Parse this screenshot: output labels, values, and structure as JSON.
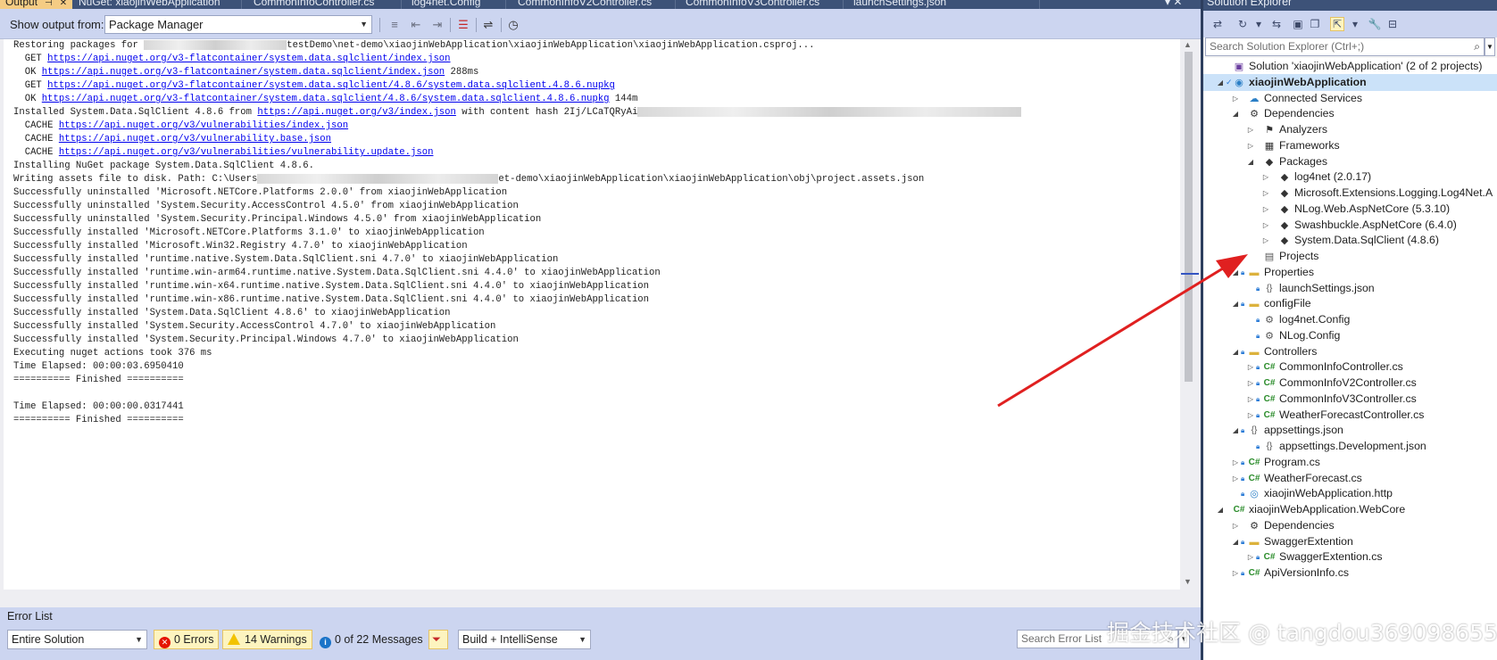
{
  "doc_tabs": {
    "output_title": "Output",
    "tabs": [
      "NuGet: xiaojinWebApplication",
      "CommonInfoController.cs",
      "log4net.Config",
      "CommonInfoV2Controller.cs",
      "CommonInfoV3Controller.cs",
      "launchSettings.json"
    ],
    "pin_icon": "pin-icon",
    "close_icon": "close-icon"
  },
  "output": {
    "show_output_label": "Show output from:",
    "source": "Package Manager",
    "lines": [
      {
        "text": "Restoring packages for ",
        "blur": 160,
        "after": "testDemo\\net-demo\\xiaojinWebApplication\\xiaojinWebApplication\\xiaojinWebApplication.csproj..."
      },
      {
        "text": "  GET ",
        "link": "https://api.nuget.org/v3-flatcontainer/system.data.sqlclient/index.json"
      },
      {
        "text": "  OK ",
        "link": "https://api.nuget.org/v3-flatcontainer/system.data.sqlclient/index.json",
        "after": " 288ms"
      },
      {
        "text": "  GET ",
        "link": "https://api.nuget.org/v3-flatcontainer/system.data.sqlclient/4.8.6/system.data.sqlclient.4.8.6.nupkg"
      },
      {
        "text": "  OK ",
        "link": "https://api.nuget.org/v3-flatcontainer/system.data.sqlclient/4.8.6/system.data.sqlclient.4.8.6.nupkg",
        "after": " 144m"
      },
      {
        "text": "Installed System.Data.SqlClient 4.8.6 from ",
        "link": "https://api.nuget.org/v3/index.json",
        "after": " with content hash 2Ij/LCaTQRyAi",
        "blur2": 430
      },
      {
        "text": "  CACHE ",
        "link": "https://api.nuget.org/v3/vulnerabilities/index.json"
      },
      {
        "text": "  CACHE ",
        "link": "https://api.nuget.org/v3/vulnerability.base.json"
      },
      {
        "text": "  CACHE ",
        "link": "https://api.nuget.org/v3/vulnerabilities/vulnerability.update.json"
      },
      {
        "text": "Installing NuGet package System.Data.SqlClient 4.8.6."
      },
      {
        "text": "Writing assets file to disk. Path: C:\\Users",
        "blur": 270,
        "after": "et-demo\\xiaojinWebApplication\\xiaojinWebApplication\\obj\\project.assets.json"
      },
      {
        "text": "Successfully uninstalled 'Microsoft.NETCore.Platforms 2.0.0' from xiaojinWebApplication"
      },
      {
        "text": "Successfully uninstalled 'System.Security.AccessControl 4.5.0' from xiaojinWebApplication"
      },
      {
        "text": "Successfully uninstalled 'System.Security.Principal.Windows 4.5.0' from xiaojinWebApplication"
      },
      {
        "text": "Successfully installed 'Microsoft.NETCore.Platforms 3.1.0' to xiaojinWebApplication"
      },
      {
        "text": "Successfully installed 'Microsoft.Win32.Registry 4.7.0' to xiaojinWebApplication"
      },
      {
        "text": "Successfully installed 'runtime.native.System.Data.SqlClient.sni 4.7.0' to xiaojinWebApplication"
      },
      {
        "text": "Successfully installed 'runtime.win-arm64.runtime.native.System.Data.SqlClient.sni 4.4.0' to xiaojinWebApplication"
      },
      {
        "text": "Successfully installed 'runtime.win-x64.runtime.native.System.Data.SqlClient.sni 4.4.0' to xiaojinWebApplication"
      },
      {
        "text": "Successfully installed 'runtime.win-x86.runtime.native.System.Data.SqlClient.sni 4.4.0' to xiaojinWebApplication"
      },
      {
        "text": "Successfully installed 'System.Data.SqlClient 4.8.6' to xiaojinWebApplication"
      },
      {
        "text": "Successfully installed 'System.Security.AccessControl 4.7.0' to xiaojinWebApplication"
      },
      {
        "text": "Successfully installed 'System.Security.Principal.Windows 4.7.0' to xiaojinWebApplication"
      },
      {
        "text": "Executing nuget actions took 376 ms"
      },
      {
        "text": "Time Elapsed: 00:00:03.6950410"
      },
      {
        "text": "========== Finished =========="
      },
      {
        "text": ""
      },
      {
        "text": "Time Elapsed: 00:00:00.0317441"
      },
      {
        "text": "========== Finished =========="
      }
    ]
  },
  "error_list": {
    "title": "Error List",
    "scope": "Entire Solution",
    "errors_label": "0 Errors",
    "warnings_label": "14 Warnings",
    "messages_label": "0 of 22 Messages",
    "build_filter": "Build + IntelliSense",
    "search_placeholder": "Search Error List"
  },
  "solution_explorer": {
    "title": "Solution Explorer",
    "search_placeholder": "Search Solution Explorer (Ctrl+;)",
    "tree": [
      {
        "label": "Solution 'xiaojinWebApplication' (2 of 2 projects)",
        "level": 0,
        "icon": "solution-icon",
        "glyph": "▣",
        "cls": "sol",
        "exp": ""
      },
      {
        "label": "xiaojinWebApplication",
        "level": 0,
        "icon": "web-project-icon",
        "glyph": "◉",
        "cls": "globe",
        "exp": "◢",
        "selected": true,
        "bold": true,
        "check": true
      },
      {
        "label": "Connected Services",
        "level": 1,
        "icon": "connected-services-icon",
        "glyph": "☁",
        "cls": "globe",
        "exp": "▷"
      },
      {
        "label": "Dependencies",
        "level": 1,
        "icon": "dependencies-icon",
        "glyph": "⚙",
        "cls": "pkg",
        "exp": "◢"
      },
      {
        "label": "Analyzers",
        "level": 2,
        "icon": "analyzers-icon",
        "glyph": "⚑",
        "cls": "pkg",
        "exp": "▷"
      },
      {
        "label": "Frameworks",
        "level": 2,
        "icon": "frameworks-icon",
        "glyph": "▦",
        "cls": "pkg",
        "exp": "▷"
      },
      {
        "label": "Packages",
        "level": 2,
        "icon": "packages-icon",
        "glyph": "◆",
        "cls": "pkg",
        "exp": "◢"
      },
      {
        "label": "log4net (2.0.17)",
        "level": 3,
        "icon": "package-icon",
        "glyph": "◆",
        "cls": "pkg",
        "exp": "▷"
      },
      {
        "label": "Microsoft.Extensions.Logging.Log4Net.A",
        "level": 3,
        "icon": "package-icon",
        "glyph": "◆",
        "cls": "pkg",
        "exp": "▷"
      },
      {
        "label": "NLog.Web.AspNetCore (5.3.10)",
        "level": 3,
        "icon": "package-icon",
        "glyph": "◆",
        "cls": "pkg",
        "exp": "▷"
      },
      {
        "label": "Swashbuckle.AspNetCore (6.4.0)",
        "level": 3,
        "icon": "package-icon",
        "glyph": "◆",
        "cls": "pkg",
        "exp": "▷"
      },
      {
        "label": "System.Data.SqlClient (4.8.6)",
        "level": 3,
        "icon": "package-icon",
        "glyph": "◆",
        "cls": "pkg",
        "exp": "▷"
      },
      {
        "label": "Projects",
        "level": 2,
        "icon": "projects-icon",
        "glyph": "▤",
        "cls": "file",
        "exp": ""
      },
      {
        "label": "Properties",
        "level": 1,
        "icon": "folder-icon",
        "glyph": "▬",
        "cls": "folder",
        "exp": "◢",
        "lock": true
      },
      {
        "label": "launchSettings.json",
        "level": 2,
        "icon": "json-file-icon",
        "glyph": "{}",
        "cls": "json",
        "exp": "",
        "lock": true
      },
      {
        "label": "configFile",
        "level": 1,
        "icon": "folder-icon",
        "glyph": "▬",
        "cls": "folder",
        "exp": "◢",
        "lock": true
      },
      {
        "label": "log4net.Config",
        "level": 2,
        "icon": "config-file-icon",
        "glyph": "⚙",
        "cls": "file",
        "exp": "",
        "lock": true
      },
      {
        "label": "NLog.Config",
        "level": 2,
        "icon": "config-file-icon",
        "glyph": "⚙",
        "cls": "file",
        "exp": "",
        "lock": true
      },
      {
        "label": "Controllers",
        "level": 1,
        "icon": "folder-icon",
        "glyph": "▬",
        "cls": "folder",
        "exp": "◢",
        "lock": true
      },
      {
        "label": "CommonInfoController.cs",
        "level": 2,
        "icon": "csharp-file-icon",
        "glyph": "C#",
        "cls": "cs",
        "exp": "▷",
        "lock": true
      },
      {
        "label": "CommonInfoV2Controller.cs",
        "level": 2,
        "icon": "csharp-file-icon",
        "glyph": "C#",
        "cls": "cs",
        "exp": "▷",
        "lock": true
      },
      {
        "label": "CommonInfoV3Controller.cs",
        "level": 2,
        "icon": "csharp-file-icon",
        "glyph": "C#",
        "cls": "cs",
        "exp": "▷",
        "lock": true
      },
      {
        "label": "WeatherForecastController.cs",
        "level": 2,
        "icon": "csharp-file-icon",
        "glyph": "C#",
        "cls": "cs",
        "exp": "▷",
        "lock": true
      },
      {
        "label": "appsettings.json",
        "level": 1,
        "icon": "json-file-icon",
        "glyph": "{}",
        "cls": "json",
        "exp": "◢",
        "lock": true
      },
      {
        "label": "appsettings.Development.json",
        "level": 2,
        "icon": "json-file-icon",
        "glyph": "{}",
        "cls": "json",
        "exp": "",
        "lock": true
      },
      {
        "label": "Program.cs",
        "level": 1,
        "icon": "csharp-file-icon",
        "glyph": "C#",
        "cls": "cs",
        "exp": "▷",
        "lock": true
      },
      {
        "label": "WeatherForecast.cs",
        "level": 1,
        "icon": "csharp-file-icon",
        "glyph": "C#",
        "cls": "cs",
        "exp": "▷",
        "lock": true
      },
      {
        "label": "xiaojinWebApplication.http",
        "level": 1,
        "icon": "http-file-icon",
        "glyph": "◎",
        "cls": "globe",
        "exp": "",
        "lock": true
      },
      {
        "label": "xiaojinWebApplication.WebCore",
        "level": 0,
        "icon": "csharp-project-icon",
        "glyph": "C#",
        "cls": "cs",
        "exp": "◢"
      },
      {
        "label": "Dependencies",
        "level": 1,
        "icon": "dependencies-icon",
        "glyph": "⚙",
        "cls": "pkg",
        "exp": "▷"
      },
      {
        "label": "SwaggerExtention",
        "level": 1,
        "icon": "folder-icon",
        "glyph": "▬",
        "cls": "folder",
        "exp": "◢",
        "lock": true
      },
      {
        "label": "SwaggerExtention.cs",
        "level": 2,
        "icon": "csharp-file-icon",
        "glyph": "C#",
        "cls": "cs",
        "exp": "▷",
        "lock": true
      },
      {
        "label": "ApiVersionInfo.cs",
        "level": 1,
        "icon": "csharp-file-icon",
        "glyph": "C#",
        "cls": "cs",
        "exp": "▷",
        "lock": true
      }
    ]
  },
  "watermark": "掘金技术社区 @ tangdou369098655",
  "colors": {
    "accent": "#3d5278",
    "toolbar": "#ccd5f0",
    "selected": "#cbe2f9",
    "arrow": "#e02020"
  }
}
